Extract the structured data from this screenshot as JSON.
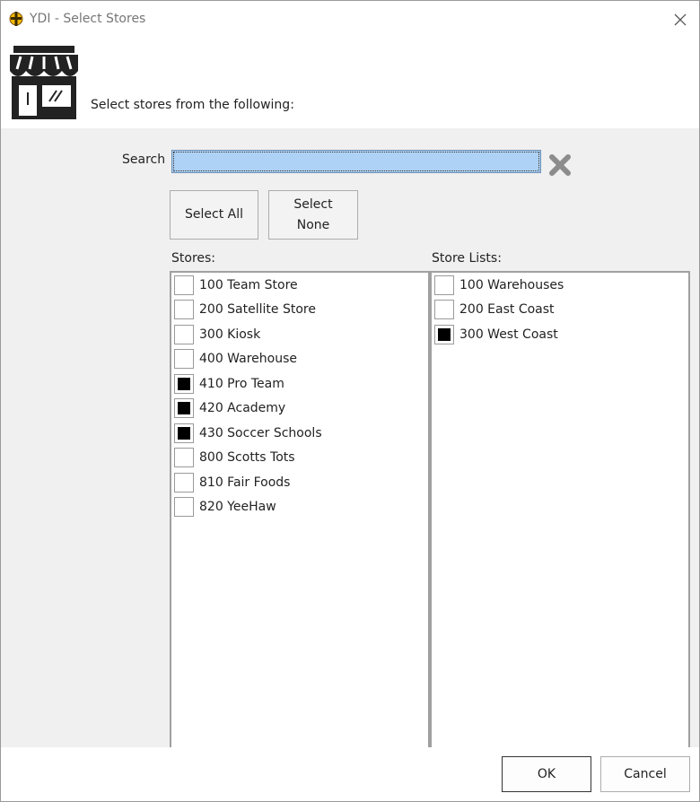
{
  "window": {
    "title": "YDI - Select Stores",
    "header_text": "Select stores from the following:"
  },
  "search": {
    "label": "Search",
    "value": ""
  },
  "buttons": {
    "select_all": "Select All",
    "select_none_line1": "Select",
    "select_none_line2": "None",
    "ok": "OK",
    "cancel": "Cancel"
  },
  "stores": {
    "label": "Stores:",
    "items": [
      {
        "label": "100 Team Store",
        "checked": false
      },
      {
        "label": "200 Satellite Store",
        "checked": false
      },
      {
        "label": "300 Kiosk",
        "checked": false
      },
      {
        "label": "400 Warehouse",
        "checked": false
      },
      {
        "label": "410 Pro Team",
        "checked": true
      },
      {
        "label": "420 Academy",
        "checked": true
      },
      {
        "label": "430 Soccer Schools",
        "checked": true
      },
      {
        "label": "800 Scotts Tots",
        "checked": false
      },
      {
        "label": "810 Fair Foods",
        "checked": false
      },
      {
        "label": "820 YeeHaw",
        "checked": false
      }
    ]
  },
  "store_lists": {
    "label": "Store Lists:",
    "items": [
      {
        "label": "100 Warehouses",
        "checked": false
      },
      {
        "label": "200 East Coast",
        "checked": false
      },
      {
        "label": "300 West Coast",
        "checked": true
      }
    ]
  },
  "icons": {
    "app": "ydi-app-icon",
    "store": "storefront-icon",
    "clear": "clear-x-icon",
    "close": "close-icon"
  },
  "colors": {
    "search_bg": "#aed2f5",
    "body_bg": "#f0f0f0",
    "checkbox_fill": "#000000"
  }
}
